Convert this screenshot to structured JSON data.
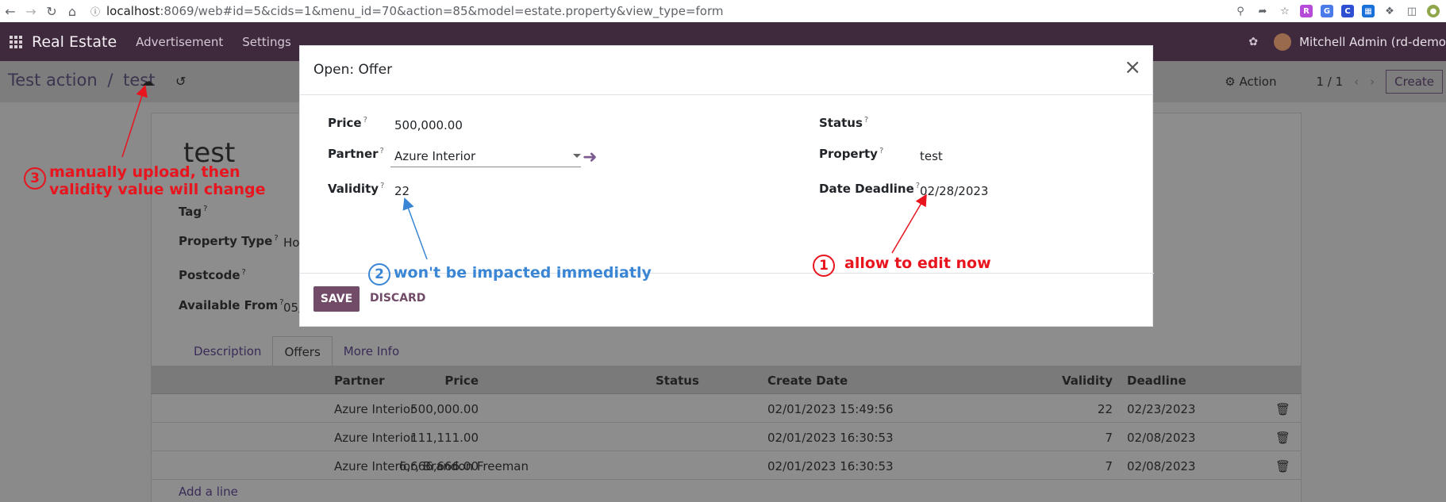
{
  "browser": {
    "url_host": "localhost",
    "url_rest": ":8069/web#id=5&cids=1&menu_id=70&action=85&model=estate.property&view_type=form"
  },
  "navbar": {
    "app_name": "Real Estate",
    "menu_items": [
      "Advertisement",
      "Settings"
    ],
    "user": "Mitchell Admin (rd-demo"
  },
  "control_panel": {
    "breadcrumb_parent": "Test action",
    "breadcrumb_sep": "/",
    "breadcrumb_current": "test",
    "action_label": "Action",
    "pager": "1 / 1",
    "create_label": "Create"
  },
  "sheet": {
    "title": "test",
    "tag_label": "Tag",
    "property_type_label": "Property Type",
    "property_type_value": "Ho",
    "postcode_label": "Postcode",
    "available_from_label": "Available From",
    "available_from_value": "05/",
    "tabs": [
      "Description",
      "Offers",
      "More Info"
    ],
    "active_tab": "Offers"
  },
  "offers_table": {
    "headers": {
      "price": "Price",
      "partner": "Partner",
      "status": "Status",
      "create_date": "Create Date",
      "validity": "Validity",
      "deadline": "Deadline"
    },
    "rows": [
      {
        "price": "500,000.00",
        "partner": "Azure Interior",
        "status": "",
        "create_date": "02/01/2023 15:49:56",
        "validity": "22",
        "deadline": "02/23/2023"
      },
      {
        "price": "111,111.00",
        "partner": "Azure Interior",
        "status": "",
        "create_date": "02/01/2023 16:30:53",
        "validity": "7",
        "deadline": "02/08/2023"
      },
      {
        "price": "6,666,666.00",
        "partner": "Azure Interior, Brandon Freeman",
        "status": "",
        "create_date": "02/01/2023 16:30:53",
        "validity": "7",
        "deadline": "02/08/2023"
      }
    ],
    "add_line": "Add a line"
  },
  "modal": {
    "title": "Open: Offer",
    "price_label": "Price",
    "price_value": "500,000.00",
    "partner_label": "Partner",
    "partner_value": "Azure Interior",
    "validity_label": "Validity",
    "validity_value": "22",
    "status_label": "Status",
    "status_value": "",
    "property_label": "Property",
    "property_value": "test",
    "deadline_label": "Date Deadline",
    "deadline_value": "02/28/2023",
    "help_mark": "?",
    "save_label": "SAVE",
    "discard_label": "DISCARD"
  },
  "annotations": {
    "a1_num": "1",
    "a1_text": "allow to edit now",
    "a2_num": "2",
    "a2_text": "won't be impacted immediatly",
    "a3_num": "3",
    "a3_line1": "manually upload, then",
    "a3_line2": "validity value will change",
    "red": "#e8141e",
    "blue": "#3a86d4"
  },
  "colors": {
    "navbar": "#3f2a3d",
    "primary": "#714b67"
  }
}
